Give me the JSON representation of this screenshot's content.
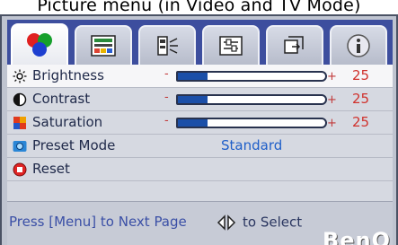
{
  "caption": "Picture menu (in Video and TV Mode)",
  "tabs": [
    {
      "icon": "color-circles-icon",
      "active": true
    },
    {
      "icon": "display-settings-icon",
      "active": false
    },
    {
      "icon": "audio-icon",
      "active": false
    },
    {
      "icon": "setup-icon",
      "active": false
    },
    {
      "icon": "input-source-icon",
      "active": false
    },
    {
      "icon": "info-icon",
      "active": false
    }
  ],
  "menu": {
    "brightness": {
      "label": "Brightness",
      "minus": "-",
      "plus": "+",
      "value": "25",
      "level": 0.2
    },
    "contrast": {
      "label": "Contrast",
      "minus": "-",
      "plus": "+",
      "value": "25",
      "level": 0.2
    },
    "saturation": {
      "label": "Saturation",
      "minus": "-",
      "plus": "+",
      "value": "25",
      "level": 0.2
    },
    "preset_mode": {
      "label": "Preset Mode",
      "value": "Standard"
    },
    "reset": {
      "label": "Reset"
    }
  },
  "footer": {
    "hint": "Press [Menu] to Next Page",
    "select_hint": "to Select",
    "brand": "BenQ"
  },
  "colors": {
    "tab_bar": "#3d4e9e",
    "value_red": "#d0322d",
    "mode_blue": "#1f5fc9",
    "slider_fill": "#1b4fa8"
  }
}
